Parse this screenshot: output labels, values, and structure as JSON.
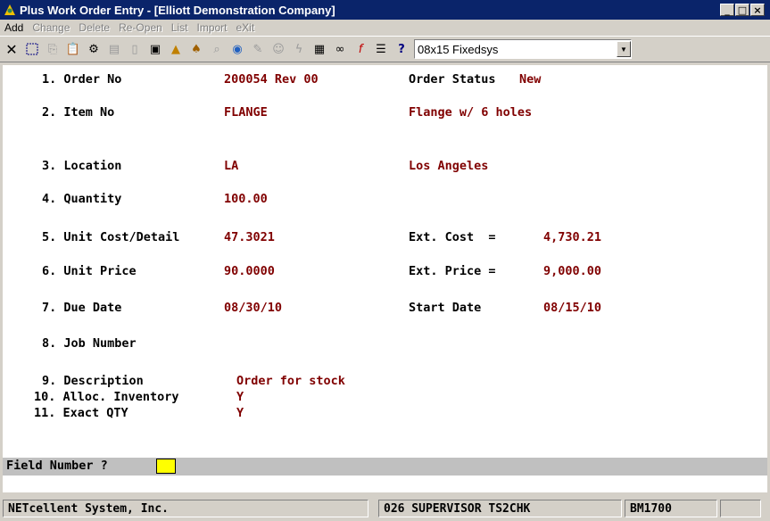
{
  "window": {
    "title": "Plus Work Order Entry - [Elliott Demonstration Company]"
  },
  "menu": [
    "Add",
    "Change",
    "Delete",
    "Re-Open",
    "List",
    "Import",
    "eXit"
  ],
  "toolbar": {
    "font_value": "08x15 Fixedsys"
  },
  "form": {
    "f1_label": "1. Order No",
    "f1_value": "200054 Rev 00",
    "order_status_label": "Order Status",
    "order_status_value": "New",
    "f2_label": "2. Item No",
    "f2_value": "FLANGE",
    "f2_desc": "Flange w/ 6 holes",
    "f3_label": "3. Location",
    "f3_value": "LA",
    "f3_desc": "Los Angeles",
    "f4_label": "4. Quantity",
    "f4_value": "100.00",
    "f5_label": "5. Unit Cost/Detail",
    "f5_value": "47.3021",
    "ext_cost_label": "Ext. Cost  =",
    "ext_cost_value": "4,730.21",
    "f6_label": "6. Unit Price",
    "f6_value": "90.0000",
    "ext_price_label": "Ext. Price =",
    "ext_price_value": "9,000.00",
    "f7_label": "7. Due Date",
    "f7_value": "08/30/10",
    "start_date_label": "Start Date",
    "start_date_value": "08/15/10",
    "f8_label": "8. Job Number",
    "f9_label": "9. Description",
    "f9_value": "Order for stock",
    "f10_label": "10. Alloc. Inventory",
    "f10_value": "Y",
    "f11_label": "11. Exact QTY",
    "f11_value": "Y",
    "prompt": "Field Number ?"
  },
  "status": {
    "company": "NETcellent System, Inc.",
    "user": "026 SUPERVISOR TS2CHK",
    "program": "BM1700"
  }
}
